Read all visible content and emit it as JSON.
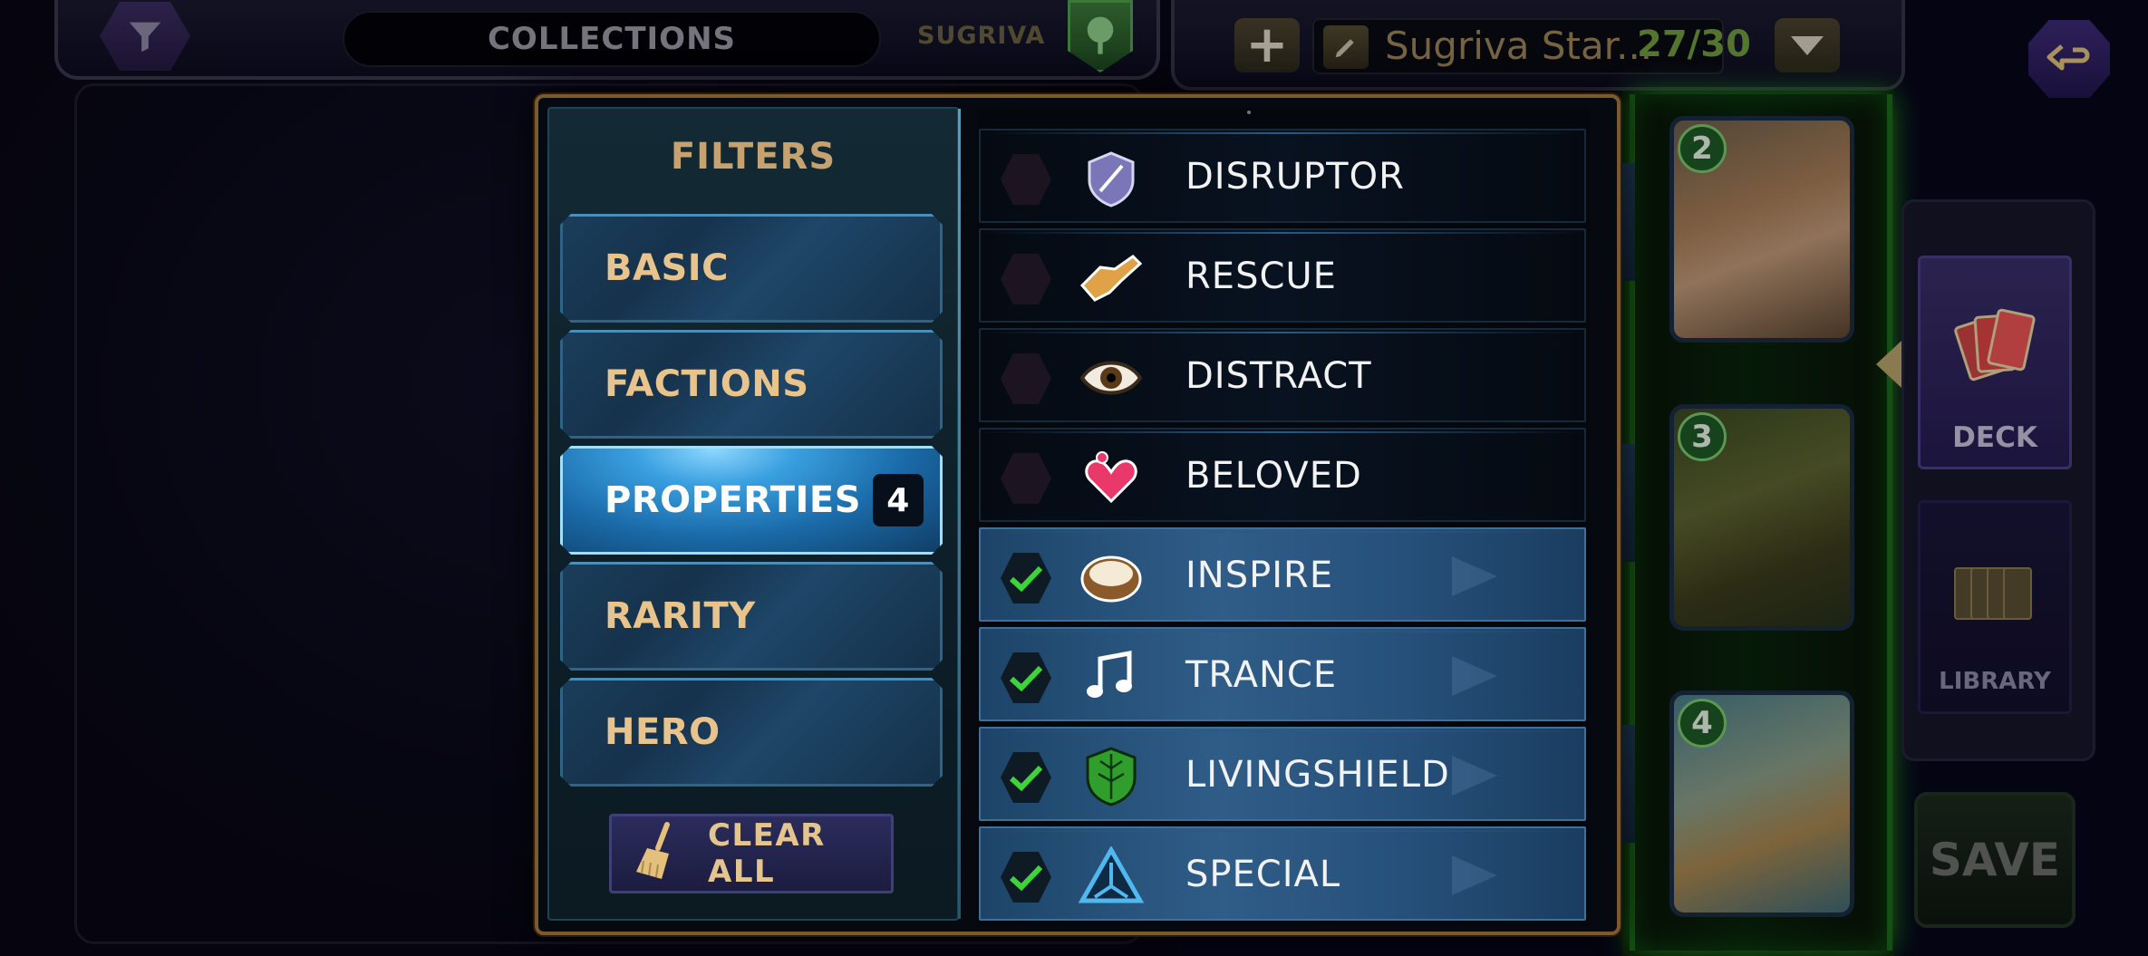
{
  "header": {
    "collections_label": "COLLECTIONS",
    "hero_name": "SUGRIVA",
    "deck_name": "Sugriva Star...",
    "deck_count": "27/30",
    "add_label": "+"
  },
  "deck_cards": [
    {
      "cost": "2"
    },
    {
      "cost": "3"
    },
    {
      "cost": "4"
    }
  ],
  "right_menu": {
    "deck_label": "DECK",
    "library_label": "LIBRARY",
    "save_label": "SAVE"
  },
  "filters": {
    "title": "FILTERS",
    "categories": [
      {
        "label": "BASIC",
        "active": false
      },
      {
        "label": "FACTIONS",
        "active": false
      },
      {
        "label": "PROPERTIES",
        "active": true,
        "count": "4"
      },
      {
        "label": "RARITY",
        "active": false
      },
      {
        "label": "HERO",
        "active": false
      }
    ],
    "clear_all_label": "CLEAR ALL"
  },
  "properties": [
    {
      "label": "DISRUPTOR",
      "icon": "disruptor-shield-icon",
      "checked": false
    },
    {
      "label": "RESCUE",
      "icon": "rescue-handshake-icon",
      "checked": false
    },
    {
      "label": "DISTRACT",
      "icon": "distract-eye-icon",
      "checked": false
    },
    {
      "label": "BELOVED",
      "icon": "beloved-heart-icon",
      "checked": false
    },
    {
      "label": "INSPIRE",
      "icon": "inspire-coconut-icon",
      "checked": true
    },
    {
      "label": "TRANCE",
      "icon": "trance-music-note-icon",
      "checked": true
    },
    {
      "label": "LIVINGSHIELD",
      "icon": "livingshield-leaf-shield-icon",
      "checked": true
    },
    {
      "label": "SPECIAL",
      "icon": "special-triangle-icon",
      "checked": true
    }
  ],
  "colors": {
    "accent_gold": "#c6a270",
    "check_green": "#3dd43a",
    "active_blue": "#3aa0e0"
  }
}
